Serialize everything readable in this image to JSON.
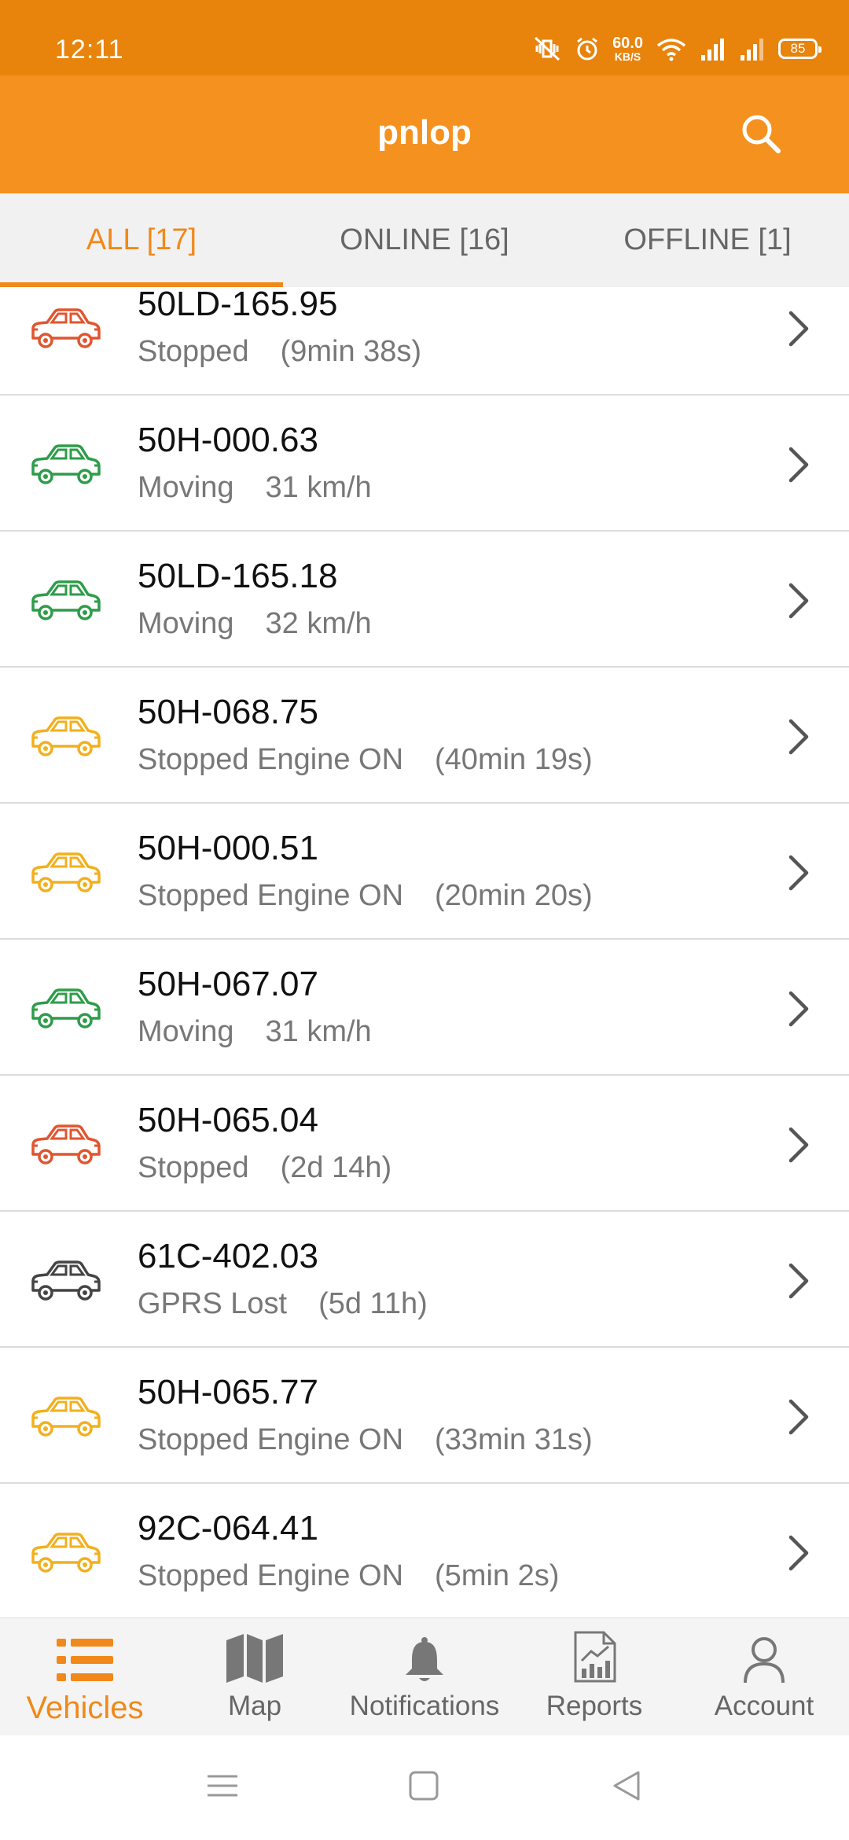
{
  "status_bar": {
    "time": "12:11",
    "net_speed_value": "60.0",
    "net_speed_unit": "KB/S",
    "battery": "85"
  },
  "app_bar": {
    "title": "pnlop",
    "search_icon": "search-icon"
  },
  "tabs": [
    {
      "label": "ALL [17]",
      "active": true
    },
    {
      "label": "ONLINE [16]",
      "active": false
    },
    {
      "label": "OFFLINE [1]",
      "active": false
    }
  ],
  "colors": {
    "accent": "#f0891a",
    "status_bar": "#e8830c",
    "app_bar": "#f5921f",
    "stopped": "#e0552f",
    "moving": "#2e9c4a",
    "engine_on": "#f2b01e",
    "gprs_lost": "#444444"
  },
  "vehicles": [
    {
      "plate": "50LD-165.95",
      "state": "Stopped",
      "detail": "(9min 38s)",
      "car_color": "stopped"
    },
    {
      "plate": "50H-000.63",
      "state": "Moving",
      "detail": "31 km/h",
      "car_color": "moving"
    },
    {
      "plate": "50LD-165.18",
      "state": "Moving",
      "detail": "32 km/h",
      "car_color": "moving"
    },
    {
      "plate": "50H-068.75",
      "state": "Stopped Engine ON",
      "detail": "(40min 19s)",
      "car_color": "engine_on"
    },
    {
      "plate": "50H-000.51",
      "state": "Stopped Engine ON",
      "detail": "(20min 20s)",
      "car_color": "engine_on"
    },
    {
      "plate": "50H-067.07",
      "state": "Moving",
      "detail": "31 km/h",
      "car_color": "moving"
    },
    {
      "plate": "50H-065.04",
      "state": "Stopped",
      "detail": "(2d 14h)",
      "car_color": "stopped"
    },
    {
      "plate": "61C-402.03",
      "state": "GPRS Lost",
      "detail": "(5d 11h)",
      "car_color": "gprs_lost"
    },
    {
      "plate": "50H-065.77",
      "state": "Stopped Engine ON",
      "detail": "(33min 31s)",
      "car_color": "engine_on"
    },
    {
      "plate": "92C-064.41",
      "state": "Stopped Engine ON",
      "detail": "(5min 2s)",
      "car_color": "engine_on"
    }
  ],
  "bottom_nav": [
    {
      "label": "Vehicles",
      "icon": "list-icon",
      "active": true
    },
    {
      "label": "Map",
      "icon": "map-icon",
      "active": false
    },
    {
      "label": "Notifications",
      "icon": "bell-icon",
      "active": false
    },
    {
      "label": "Reports",
      "icon": "reports-icon",
      "active": false
    },
    {
      "label": "Account",
      "icon": "account-icon",
      "active": false
    }
  ],
  "system_nav": [
    "menu-icon",
    "home-icon",
    "back-icon"
  ]
}
